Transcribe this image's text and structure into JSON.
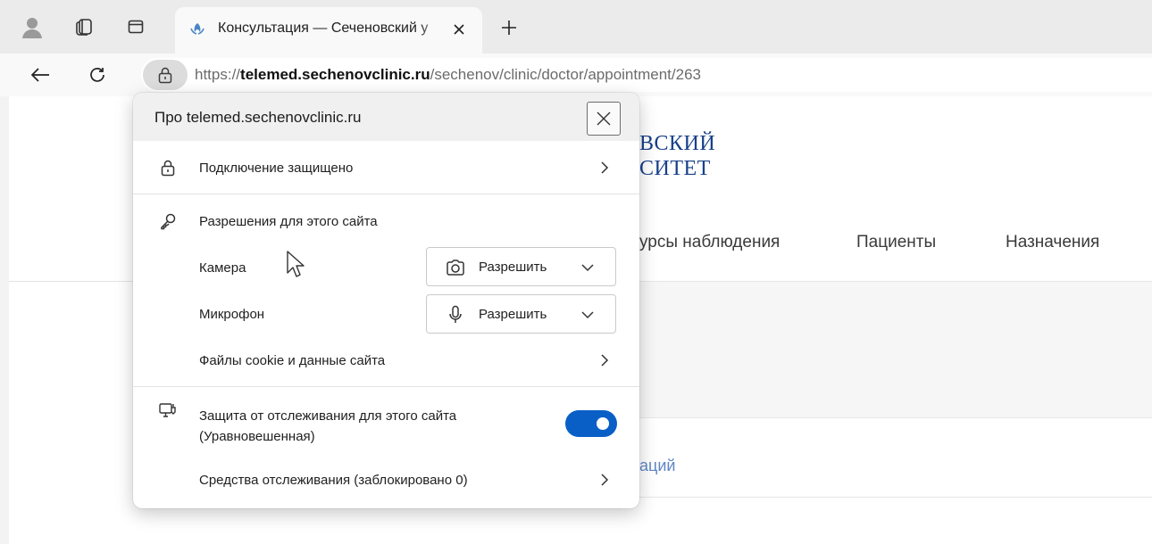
{
  "browser": {
    "tab": {
      "title": "Консультация — Сеченовский у"
    },
    "url": {
      "scheme": "https://",
      "host": "telemed.sechenovclinic.ru",
      "path": "/sechenov/clinic/doctor/appointment/263"
    }
  },
  "page": {
    "logo_line1": "ВСКИЙ",
    "logo_line2": "СИТЕТ",
    "menu": [
      "урсы наблюдения",
      "Пациенты",
      "Назначения"
    ],
    "link_fragment": "аций"
  },
  "popup": {
    "title": "Про telemed.sechenovclinic.ru",
    "connection": "Подключение защищено",
    "permissions_heading": "Разрешения для этого сайта",
    "camera_label": "Камера",
    "camera_value": "Разрешить",
    "mic_label": "Микрофон",
    "mic_value": "Разрешить",
    "cookies": "Файлы cookie и данные сайта",
    "tracking_line1": "Защита от отслеживания для этого сайта",
    "tracking_line2": "(Уравновешенная)",
    "tracking_enabled": true,
    "trackers": "Средства отслеживания (заблокировано 0)"
  },
  "colors": {
    "accent": "#0a5fc7",
    "logo": "#17408a",
    "link": "#5f86c6"
  }
}
